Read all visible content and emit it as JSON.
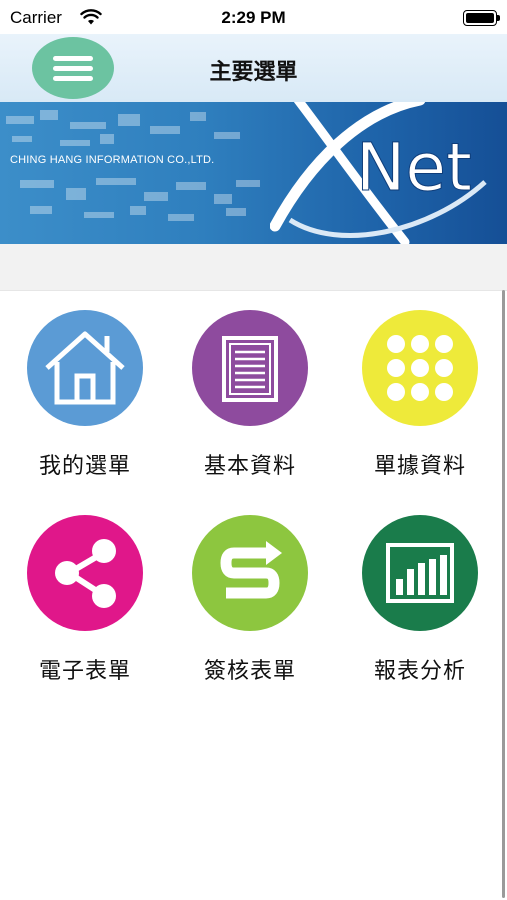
{
  "status_bar": {
    "carrier": "Carrier",
    "time": "2:29 PM"
  },
  "nav": {
    "title": "主要選單",
    "menu_icon": "hamburger-icon"
  },
  "banner": {
    "company": "CHING HANG INFORMATION CO.,LTD.",
    "logo_text": "Net"
  },
  "menu": {
    "items": [
      {
        "label": "我的選單",
        "icon": "home-icon",
        "color": "#5b9bd5"
      },
      {
        "label": "基本資料",
        "icon": "document-icon",
        "color": "#8e4b9e"
      },
      {
        "label": "單據資料",
        "icon": "grid-dots-icon",
        "color": "#eeea3a"
      },
      {
        "label": "電子表單",
        "icon": "share-icon",
        "color": "#e0178a"
      },
      {
        "label": "簽核表單",
        "icon": "approval-icon",
        "color": "#8dc63f"
      },
      {
        "label": "報表分析",
        "icon": "bar-chart-icon",
        "color": "#1a7c4b"
      }
    ]
  }
}
